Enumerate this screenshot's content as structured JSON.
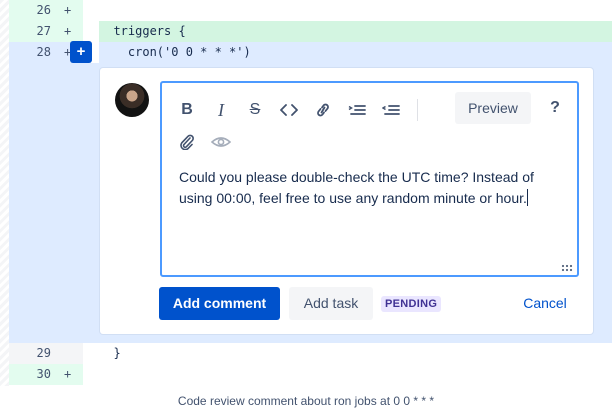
{
  "diff": {
    "lines": [
      {
        "number": "26",
        "marker": "+",
        "code": ""
      },
      {
        "number": "27",
        "marker": "+",
        "code": "  triggers {"
      },
      {
        "number": "28",
        "marker": "+",
        "code": "    cron('0 0 * * *')"
      },
      {
        "number": "29",
        "marker": "",
        "code": "  }"
      },
      {
        "number": "30",
        "marker": "+",
        "code": ""
      }
    ],
    "add_comment_icon": "plus-icon"
  },
  "comment": {
    "avatar_icon": "user-avatar",
    "toolbar": {
      "bold": "B",
      "italic": "I",
      "strikethrough": "S",
      "code_icon": "code-icon",
      "link_icon": "link-icon",
      "indent_icon": "indent-icon",
      "outdent_icon": "outdent-icon",
      "attach_icon": "paperclip-icon",
      "mention_icon": "eye-icon",
      "preview_label": "Preview",
      "help_label": "?"
    },
    "text": "Could you please double-check the UTC time? Instead of using 00:00, feel free to use any random minute or hour.",
    "actions": {
      "add_comment": "Add comment",
      "add_task": "Add task",
      "status_badge": "PENDING",
      "cancel": "Cancel"
    }
  },
  "caption": "Code review comment about ron jobs at 0 0 * * *",
  "colors": {
    "accent": "#0052cc",
    "added_line": "#e3fcef",
    "selected_line": "#deebff",
    "focus_border": "#4c9aff",
    "pending_badge": "#eae6ff"
  }
}
